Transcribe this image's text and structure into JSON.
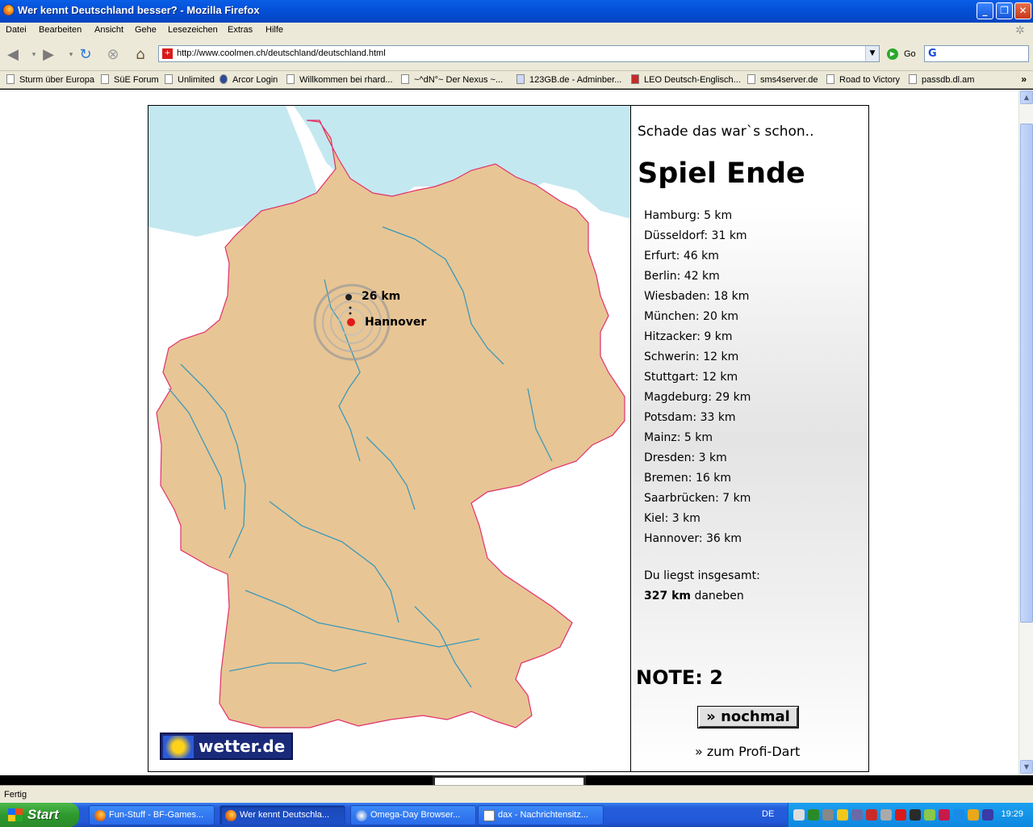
{
  "window": {
    "title": "Wer kennt Deutschland besser? - Mozilla Firefox"
  },
  "menu": [
    "Datei",
    "Bearbeiten",
    "Ansicht",
    "Gehe",
    "Lesezeichen",
    "Extras",
    "Hilfe"
  ],
  "nav": {
    "url": "http://www.coolmen.ch/deutschland/deutschland.html",
    "go_label": "Go"
  },
  "bookmarks": [
    "Sturm über Europa",
    "SüE Forum",
    "Unlimited",
    "Arcor Login",
    "Willkommen bei rhard...",
    "~^dN°~ Der Nexus ~...",
    "123GB.de - Adminber...",
    "LEO Deutsch-Englisch...",
    "sms4server.de",
    "Road to Victory",
    "passdb.dl.am"
  ],
  "game": {
    "message": "Schade das war`s schon..",
    "heading": "Spiel Ende",
    "results": [
      "Hamburg: 5 km",
      "Düsseldorf: 31 km",
      "Erfurt: 46 km",
      "Berlin: 42 km",
      "Wiesbaden: 18 km",
      "München: 20 km",
      "Hitzacker: 9 km",
      "Schwerin: 12 km",
      "Stuttgart: 12 km",
      "Magdeburg: 29 km",
      "Potsdam: 33 km",
      "Mainz: 5 km",
      "Dresden: 3 km",
      "Bremen: 16 km",
      "Saarbrücken: 7 km",
      "Kiel: 3 km",
      "Hannover: 36 km"
    ],
    "total_label": "Du liegst insgesamt:",
    "total_value": "327  km",
    "total_suffix": "daneben",
    "note": "NOTE: 2",
    "again_label": "» nochmal",
    "profi_label": "» zum Profi-Dart",
    "map": {
      "distance_label": "26 km",
      "city_label": "Hannover",
      "logo_text": "wetter.de",
      "land_color": "#e8c595",
      "sea_color": "#c4e8f0",
      "border_color": "#e0306a",
      "river_color": "#3a9ab8"
    }
  },
  "status": "Fertig",
  "taskbar": {
    "start": "Start",
    "tasks": [
      "Fun-Stuff - BF-Games...",
      "Wer kennt Deutschla...",
      "Omega-Day Browser...",
      "dax - Nachrichtensitz..."
    ],
    "lang": "DE",
    "clock": "19:29"
  }
}
